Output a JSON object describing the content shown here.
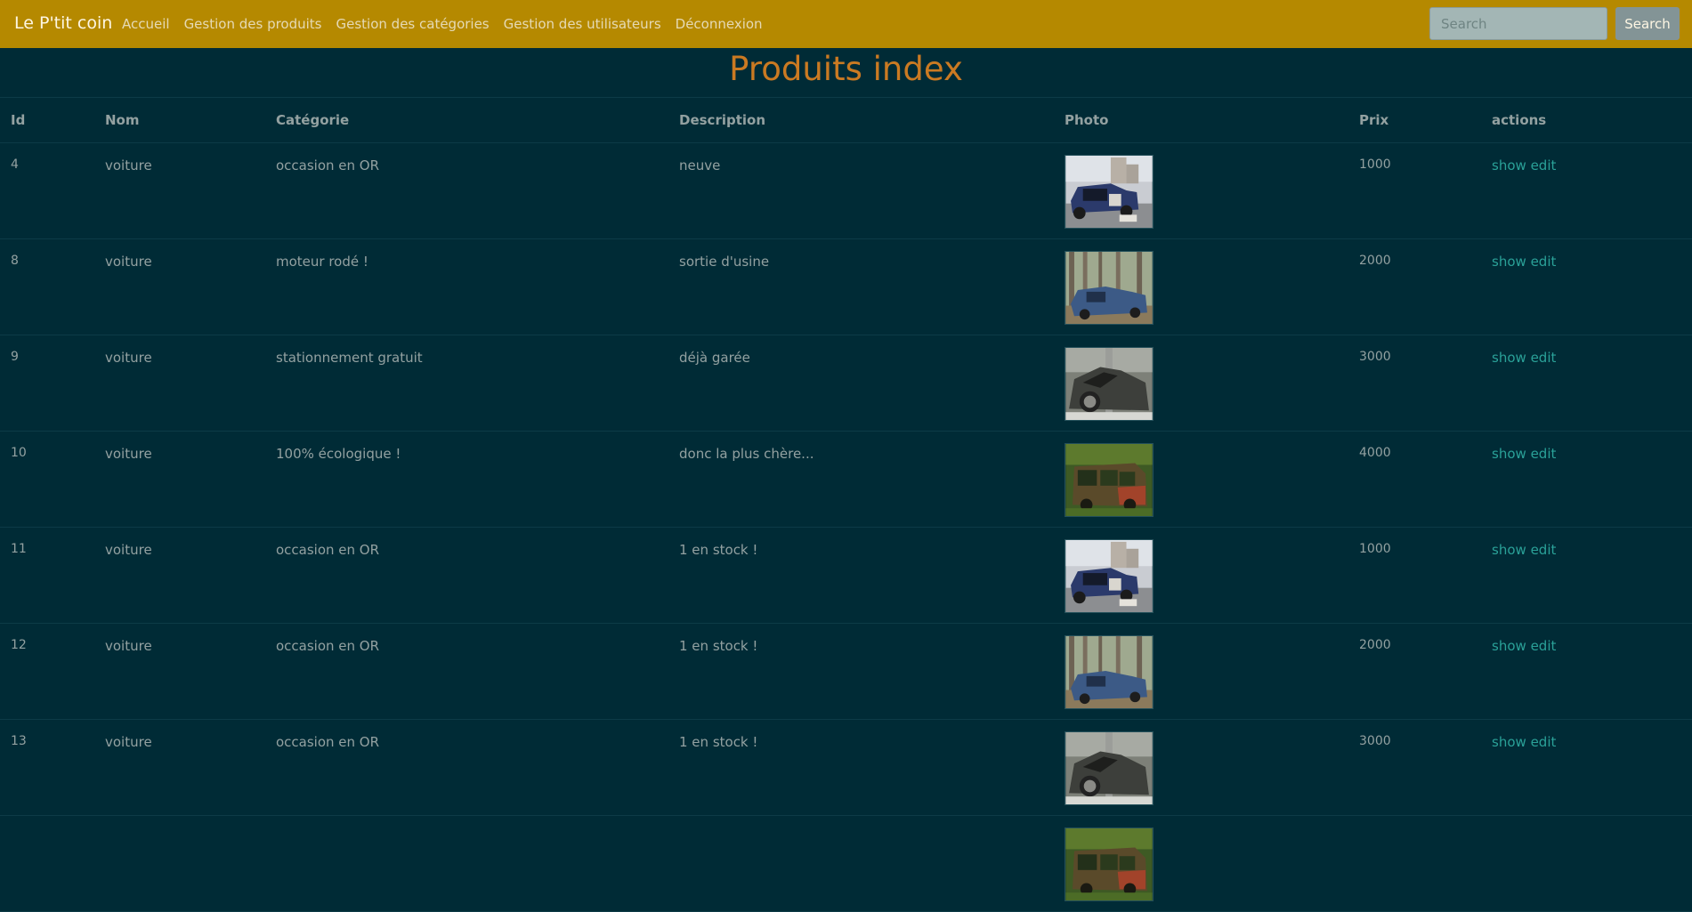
{
  "navbar": {
    "brand": "Le P'tit coin",
    "links": [
      "Accueil",
      "Gestion des produits",
      "Gestion des catégories",
      "Gestion des utilisateurs",
      "Déconnexion"
    ],
    "search_placeholder": "Search",
    "search_button": "Search"
  },
  "page": {
    "title": "Produits index"
  },
  "table": {
    "headers": [
      "Id",
      "Nom",
      "Catégorie",
      "Description",
      "Photo",
      "Prix",
      "actions"
    ],
    "rows": [
      {
        "id": "4",
        "nom": "voiture",
        "categorie": "occasion en OR",
        "description": "neuve",
        "photo": "car-wreck-blue-street",
        "prix": "1000",
        "show": "show",
        "edit": "edit"
      },
      {
        "id": "8",
        "nom": "voiture",
        "categorie": "moteur rodé !",
        "description": "sortie d'usine",
        "photo": "car-wreck-blue-forest",
        "prix": "2000",
        "show": "show",
        "edit": "edit"
      },
      {
        "id": "9",
        "nom": "voiture",
        "categorie": "stationnement gratuit",
        "description": "déjà garée",
        "photo": "car-crashed-pole",
        "prix": "3000",
        "show": "show",
        "edit": "edit"
      },
      {
        "id": "10",
        "nom": "voiture",
        "categorie": "100% écologique !",
        "description": "donc la plus chère...",
        "photo": "car-overgrown-moss",
        "prix": "4000",
        "show": "show",
        "edit": "edit"
      },
      {
        "id": "11",
        "nom": "voiture",
        "categorie": "occasion en OR",
        "description": "1 en stock !",
        "photo": "car-wreck-blue-street",
        "prix": "1000",
        "show": "show",
        "edit": "edit"
      },
      {
        "id": "12",
        "nom": "voiture",
        "categorie": "occasion en OR",
        "description": "1 en stock !",
        "photo": "car-wreck-blue-forest",
        "prix": "2000",
        "show": "show",
        "edit": "edit"
      },
      {
        "id": "13",
        "nom": "voiture",
        "categorie": "occasion en OR",
        "description": "1 en stock !",
        "photo": "car-crashed-pole",
        "prix": "3000",
        "show": "show",
        "edit": "edit"
      },
      {
        "id": "",
        "nom": "",
        "categorie": "",
        "description": "",
        "photo": "car-overgrown-moss",
        "prix": "",
        "show": "",
        "edit": ""
      }
    ]
  },
  "colors": {
    "navbar_bg": "#b58900",
    "page_bg": "#002b36",
    "title": "#cb7a22",
    "link_action": "#2aa198",
    "text": "#93a1a1"
  }
}
